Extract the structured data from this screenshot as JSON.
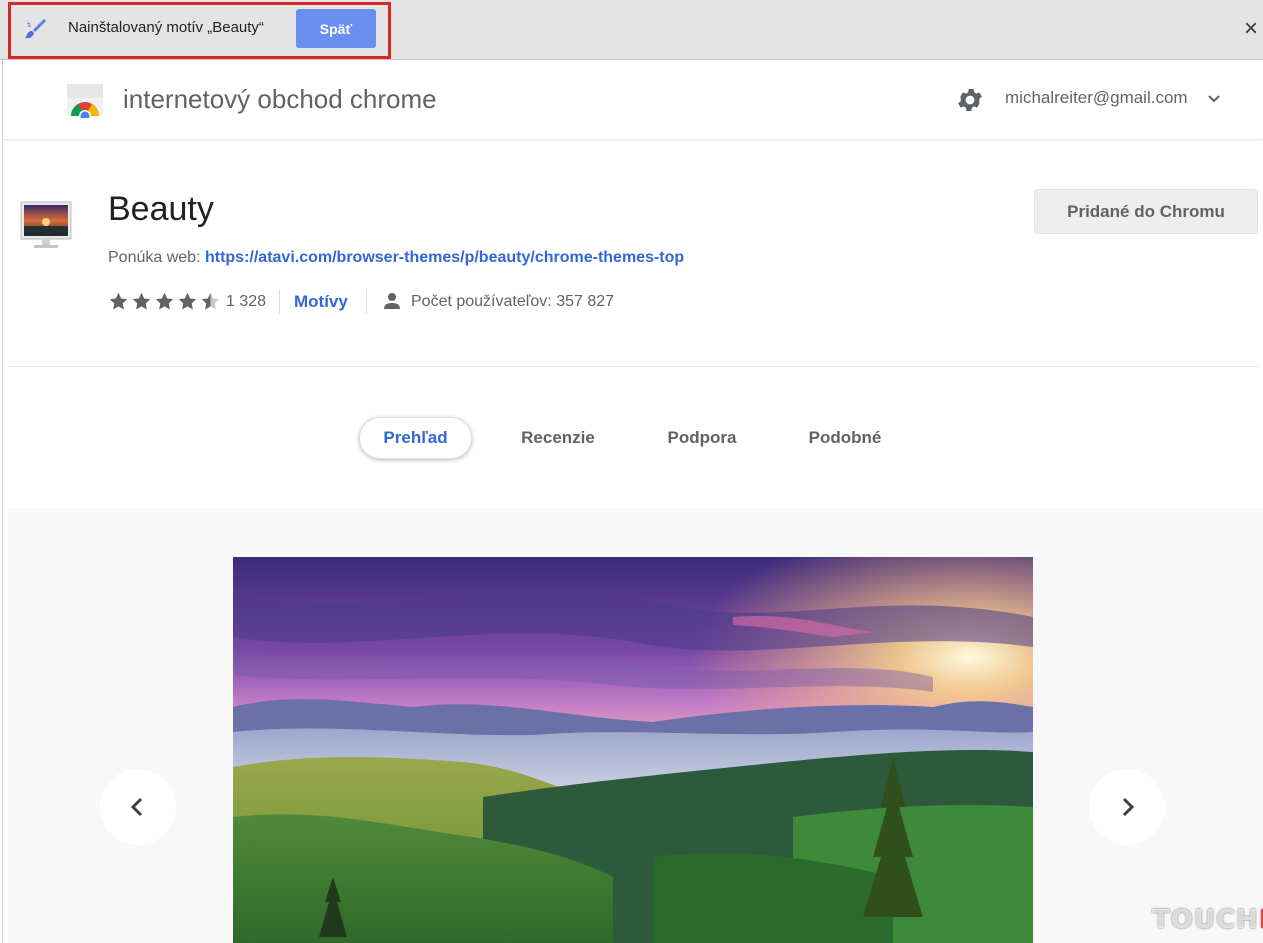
{
  "infobar": {
    "message": "Nainštalovaný motív „Beauty“",
    "undo_label": "Späť",
    "close_label": "×",
    "highlight_color": "#d9262b",
    "button_color": "#6b8ff1"
  },
  "header": {
    "title": "internetový obchod chrome",
    "account": "michalreiter@gmail.com",
    "icons": [
      "chrome-web-store-logo",
      "gear-icon",
      "chevron-down-icon"
    ]
  },
  "item": {
    "name": "Beauty",
    "offered_by_label": "Ponúka web:",
    "offered_by_url": "https://atavi.com/browser-themes/p/beauty/chrome-themes-top",
    "rating": 4.5,
    "rating_count": "1 328",
    "category": "Motívy",
    "users": "Počet používateľov: 357 827",
    "action_button": "Pridané do Chromu",
    "link_color": "#3367d6"
  },
  "tabs": [
    {
      "label": "Prehľad",
      "active": true
    },
    {
      "label": "Recenzie",
      "active": false
    },
    {
      "label": "Podpora",
      "active": false
    },
    {
      "label": "Podobné",
      "active": false
    }
  ],
  "gallery": {
    "prev_icon": "chevron-left-icon",
    "next_icon": "chevron-right-icon"
  },
  "watermark": {
    "part1": "TOUCH",
    "part2": "IT"
  }
}
